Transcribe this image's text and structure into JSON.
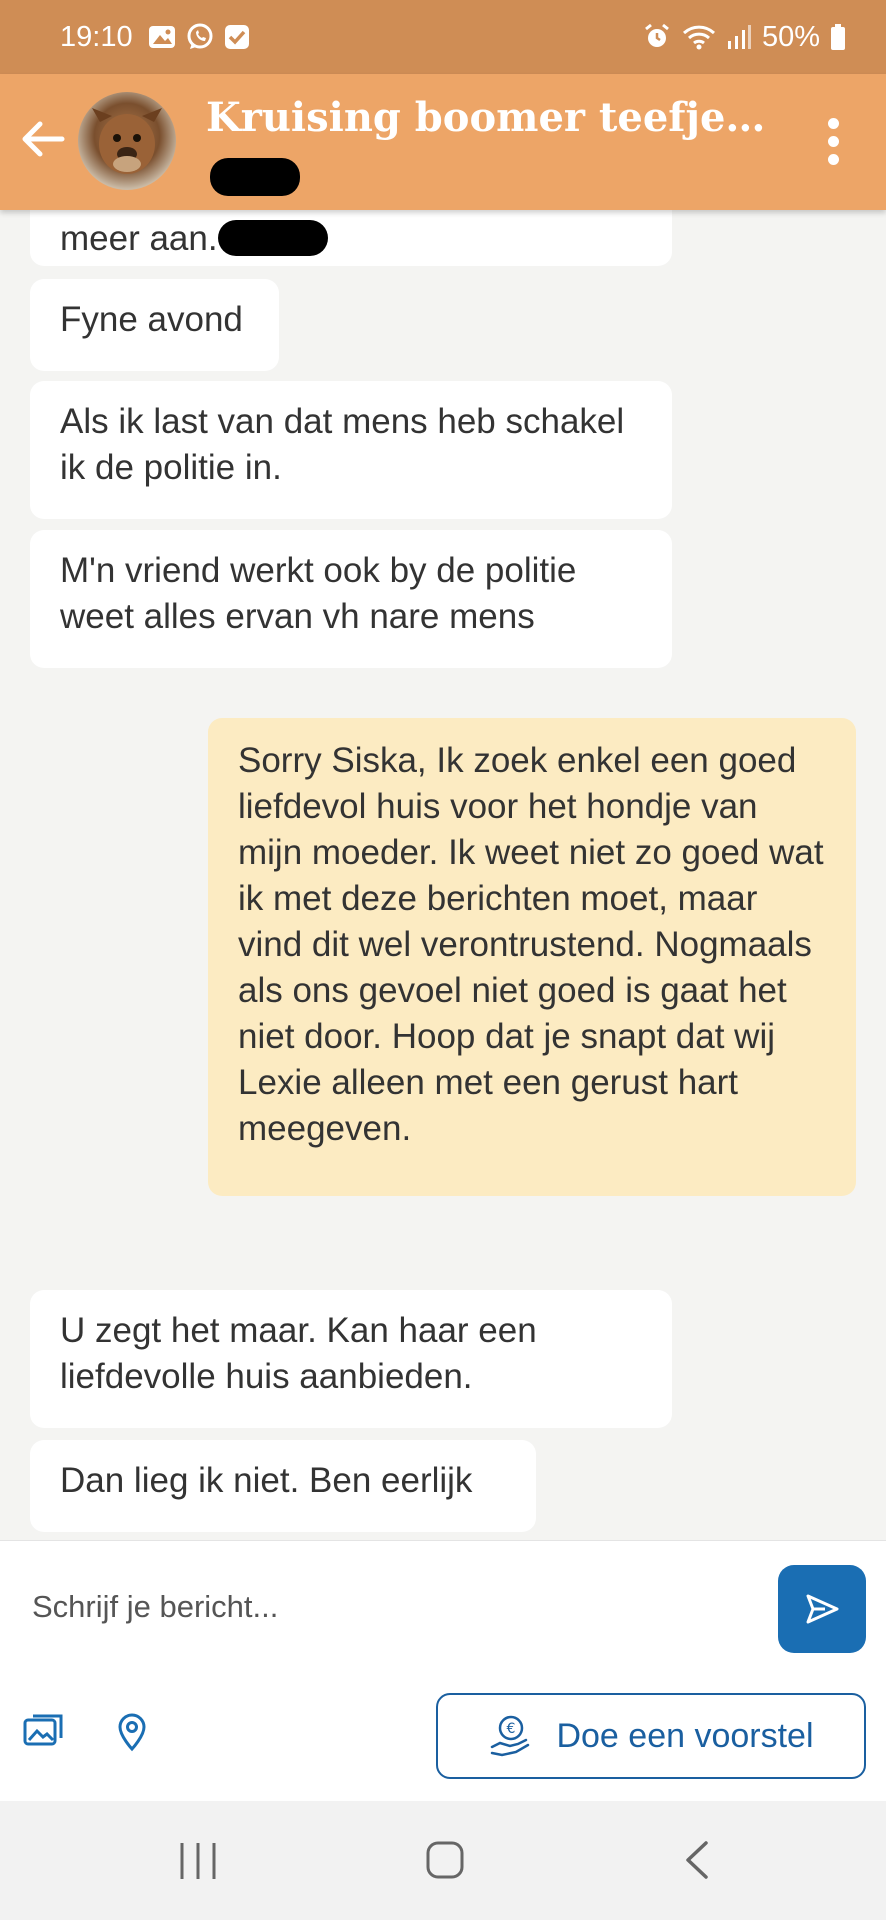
{
  "status_bar": {
    "time": "19:10",
    "battery": "50%",
    "left_icons": [
      "gallery-icon",
      "whatsapp-icon",
      "check-icon"
    ],
    "right_icons": [
      "alarm-icon",
      "wifi-icon",
      "signal-icon",
      "battery-icon"
    ]
  },
  "header": {
    "title": "Kruising boomer teefje...",
    "back_icon": "arrow-left-icon",
    "menu_icon": "more-vert-icon"
  },
  "messages": [
    {
      "direction": "in",
      "text": "meer aan."
    },
    {
      "direction": "in",
      "text": "Fyne avond"
    },
    {
      "direction": "in",
      "text": "Als ik last van dat mens heb schakel ik de politie in."
    },
    {
      "direction": "in",
      "text": "M'n vriend werkt ook by de politie weet alles ervan vh nare mens"
    },
    {
      "direction": "out",
      "text": "Sorry Siska, Ik zoek enkel een goed liefdevol huis voor het hondje van mijn moeder. Ik weet niet zo goed wat ik met deze berichten moet, maar vind dit wel verontrustend. Nogmaals als ons gevoel niet goed is gaat het niet door. Hoop dat je snapt dat wij Lexie alleen met een gerust hart meegeven."
    },
    {
      "direction": "in",
      "text": "U zegt het maar. Kan haar een liefdevolle huis aanbieden."
    },
    {
      "direction": "in",
      "text": "Dan lieg ik niet. Ben eerlijk"
    }
  ],
  "composer": {
    "placeholder": "Schrijf je bericht...",
    "send_icon": "send-icon"
  },
  "actions": {
    "image_icon": "images-icon",
    "location_icon": "location-pin-icon",
    "offer_label": "Doe een voorstel",
    "offer_icon": "euro-hand-icon"
  },
  "navbar": {
    "items": [
      "recent-apps-icon",
      "home-icon",
      "back-icon"
    ]
  },
  "colors": {
    "header": "#eda567",
    "status_bar": "#cf8d55",
    "outgoing_bubble": "#fcebc2",
    "incoming_bubble": "#ffffff",
    "accent": "#1a6eb3"
  }
}
